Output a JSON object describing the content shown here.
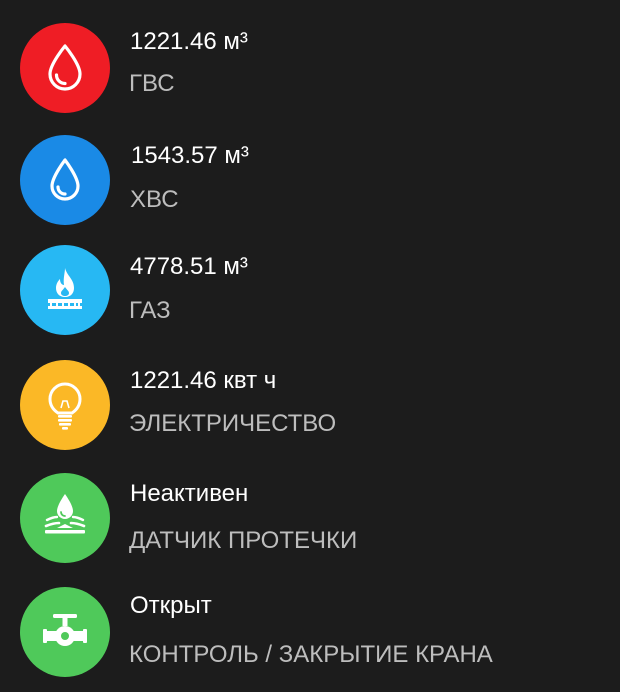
{
  "colors": {
    "background": "#1c1c1c",
    "hot_water": "#ef1d25",
    "cold_water": "#1a8ae6",
    "gas": "#27b8f3",
    "electricity": "#fbb826",
    "leak_sensor": "#4fc95a",
    "valve": "#4fc95a",
    "value_text": "#ffffff",
    "label_text": "#bdbdbd"
  },
  "items": [
    {
      "icon": "water-drop-icon",
      "value": "1221.46 м³",
      "label": "ГВС"
    },
    {
      "icon": "water-drop-icon",
      "value": "1543.57 м³",
      "label": "ХВС"
    },
    {
      "icon": "gas-flame-icon",
      "value": "4778.51 м³",
      "label": "ГАЗ"
    },
    {
      "icon": "light-bulb-icon",
      "value": "1221.46 квт ч",
      "label": "ЭЛЕКТРИЧЕСТВО"
    },
    {
      "icon": "water-leak-icon",
      "value": "Неактивен",
      "label": "ДАТЧИК ПРОТЕЧКИ"
    },
    {
      "icon": "valve-icon",
      "value": "Открыт",
      "label": "КОНТРОЛЬ / ЗАКРЫТИЕ КРАНА"
    }
  ]
}
